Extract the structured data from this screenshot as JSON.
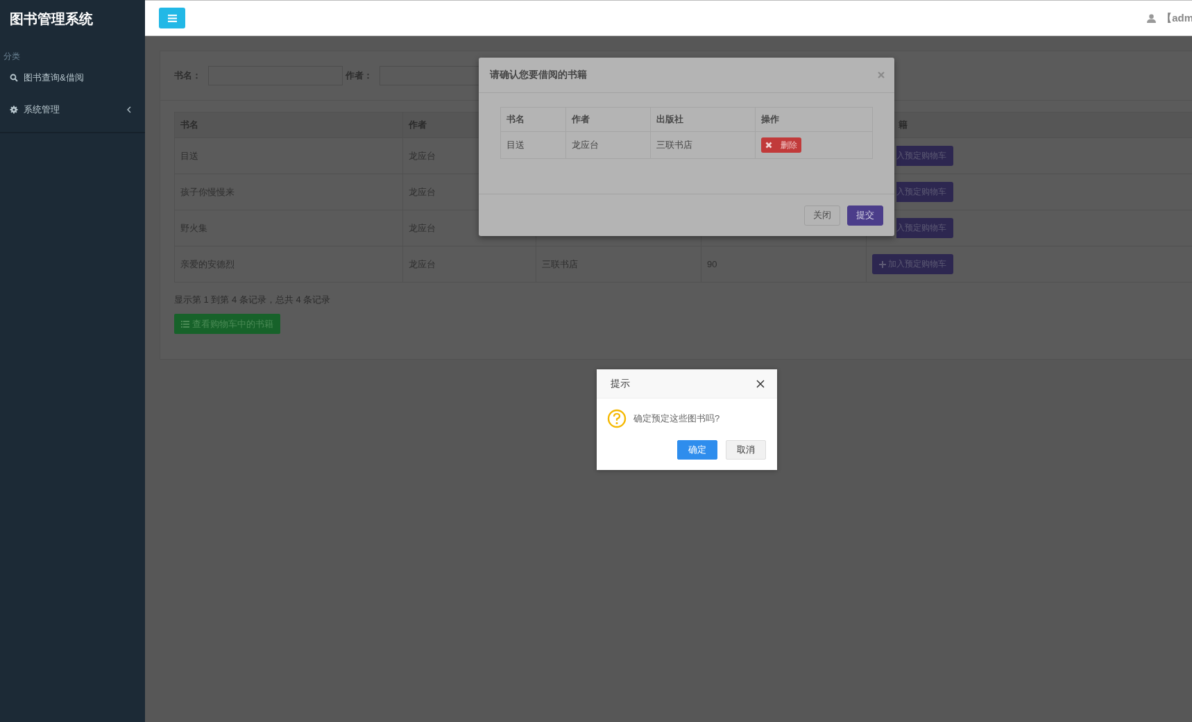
{
  "sidebar": {
    "title": "图书管理系统",
    "section": "分类",
    "items": [
      {
        "label": "图书查询&借阅",
        "expandable": false
      },
      {
        "label": "系统管理",
        "expandable": true
      }
    ]
  },
  "header": {
    "user": "【adm"
  },
  "search": {
    "fields": [
      {
        "label": "书名："
      },
      {
        "label": "作者："
      }
    ]
  },
  "table": {
    "columns": [
      "书名",
      "作者"
    ],
    "column_5": "籍",
    "rows": [
      {
        "kind": "covered",
        "title": "目送",
        "author": "龙应台",
        "button": "入预定购物车"
      },
      {
        "kind": "covered",
        "title": "孩子你慢慢来",
        "author": "龙应台",
        "button": "入预定购物车"
      },
      {
        "kind": "covered",
        "title": "野火集",
        "author": "龙应台",
        "button": "入预定购物车"
      },
      {
        "kind": "full",
        "title": "亲爱的安德烈",
        "author": "龙应台",
        "publisher": "三联书店",
        "column_4": "90",
        "button": "加入预定购物车"
      }
    ]
  },
  "summary": "显示第 1 到第 4 条记录，总共 4 条记录",
  "cart_button": "查看购物车中的书籍",
  "modal": {
    "title": "请确认您要借阅的书籍",
    "columns": [
      "书名",
      "作者",
      "出版社",
      "操作"
    ],
    "rows": [
      {
        "title": "目送",
        "author": "龙应台",
        "publisher": "三联书店",
        "action": "删除"
      }
    ],
    "buttons": [
      {
        "label": "关闭",
        "kind": "default"
      },
      {
        "label": "提交",
        "kind": "primary"
      }
    ]
  },
  "alert": {
    "title": "提示",
    "message": "确定预定这些图书吗?",
    "buttons": [
      {
        "label": "确定",
        "kind": "primary"
      },
      {
        "label": "取消",
        "kind": "default"
      }
    ]
  }
}
